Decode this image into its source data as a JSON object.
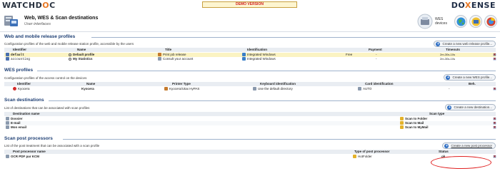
{
  "brand": {
    "left_logo": "WATCHDOC",
    "right_logo": "DOXENSE"
  },
  "demo_banner": "DEMO VERSION",
  "header": {
    "title": "Web, WES & Scan destinations",
    "subtitle": "User interfaces",
    "devices_label": "WES devices"
  },
  "web_profiles": {
    "title": "Web and mobile release profiles",
    "description": "Configuration profiles of the web and mobile release station profile, accessible by the users",
    "create_button": "Create a new web release profile...",
    "columns": [
      "Identifier",
      "Name",
      "Title",
      "Identification",
      "Payment",
      "Timeouts"
    ],
    "rows": [
      {
        "identifier": "default",
        "name": "Default profile",
        "title": "Print job release",
        "identification": "Integrated Windows",
        "payment": "Free",
        "payment_extra": "-",
        "timeouts": "2m-30s-10s"
      },
      {
        "identifier": "accounting",
        "name": "My Statistics",
        "title": "Consult your account",
        "identification": "Integrated Windows",
        "payment": "",
        "payment_extra": "-",
        "timeouts": "2m-30s-10s"
      }
    ]
  },
  "wes_profiles": {
    "title": "WES profiles",
    "description": "Configuration profiles of the access control on the devices",
    "create_button": "Create a new WES profile...",
    "columns": [
      "Identifier",
      "Name",
      "Printer Type",
      "Keyboard identification",
      "Card identification",
      "Beh."
    ],
    "rows": [
      {
        "identifier": "Kyocera",
        "name": "Kyocera",
        "printer_type": "Kyocera/Utax HyPAS",
        "keyboard": "Use the default directory",
        "card": "AUTO",
        "beh": "-"
      }
    ]
  },
  "scan_destinations": {
    "title": "Scan destinations",
    "description": "List of destinations that can be associated with scan profiles",
    "create_button": "Create a new destination...",
    "columns": [
      "Destination name",
      "Scan type"
    ],
    "rows": [
      {
        "name": "Dossier",
        "type": "Scan to Folder"
      },
      {
        "name": "E-mail",
        "type": "Scan to Mail"
      },
      {
        "name": "Mon email",
        "type": "Scan to MyMail"
      }
    ]
  },
  "scan_post": {
    "title": "Scan post processors",
    "description": "List of the post treatment that can be associated with a scan profile",
    "create_button": "Create a new post processor",
    "columns": [
      "Post processor name",
      "Type of post processor",
      "Status"
    ],
    "rows": [
      {
        "name": "OCR PDF par KCM",
        "type": "HotFolder",
        "status": "ok"
      }
    ]
  },
  "colors": {
    "section_title": "#1e3f74",
    "highlight_row": "#fbf3c2",
    "demo_text": "#d02020",
    "annotation": "#e02020"
  }
}
